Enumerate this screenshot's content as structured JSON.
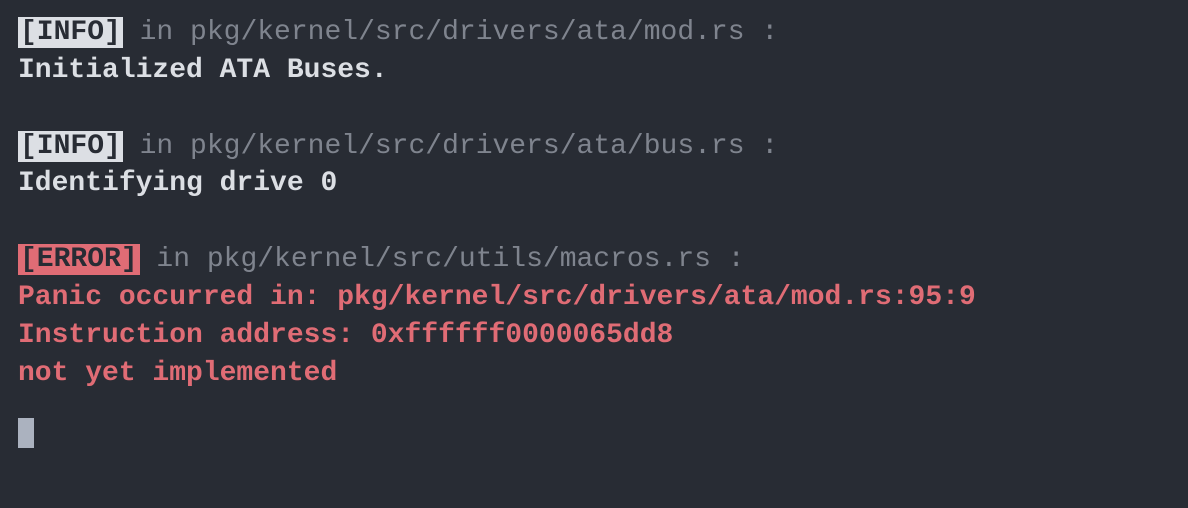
{
  "entries": [
    {
      "level": "INFO",
      "tag_class": "tag-info",
      "in_word": " in ",
      "path": "pkg/kernel/src/drivers/ata/mod.rs",
      "colon": " :",
      "msg_class": "msg-white",
      "messages": [
        "Initialized ATA Buses."
      ]
    },
    {
      "level": "INFO",
      "tag_class": "tag-info",
      "in_word": " in ",
      "path": "pkg/kernel/src/drivers/ata/bus.rs",
      "colon": " :",
      "msg_class": "msg-white",
      "messages": [
        "Identifying drive 0"
      ]
    },
    {
      "level": "ERROR",
      "tag_class": "tag-error",
      "in_word": " in ",
      "path": "pkg/kernel/src/utils/macros.rs",
      "colon": " :",
      "msg_class": "msg-error",
      "messages": [
        "Panic occurred in: pkg/kernel/src/drivers/ata/mod.rs:95:9",
        "Instruction address: 0xffffff0000065dd8",
        "not yet implemented"
      ]
    }
  ]
}
